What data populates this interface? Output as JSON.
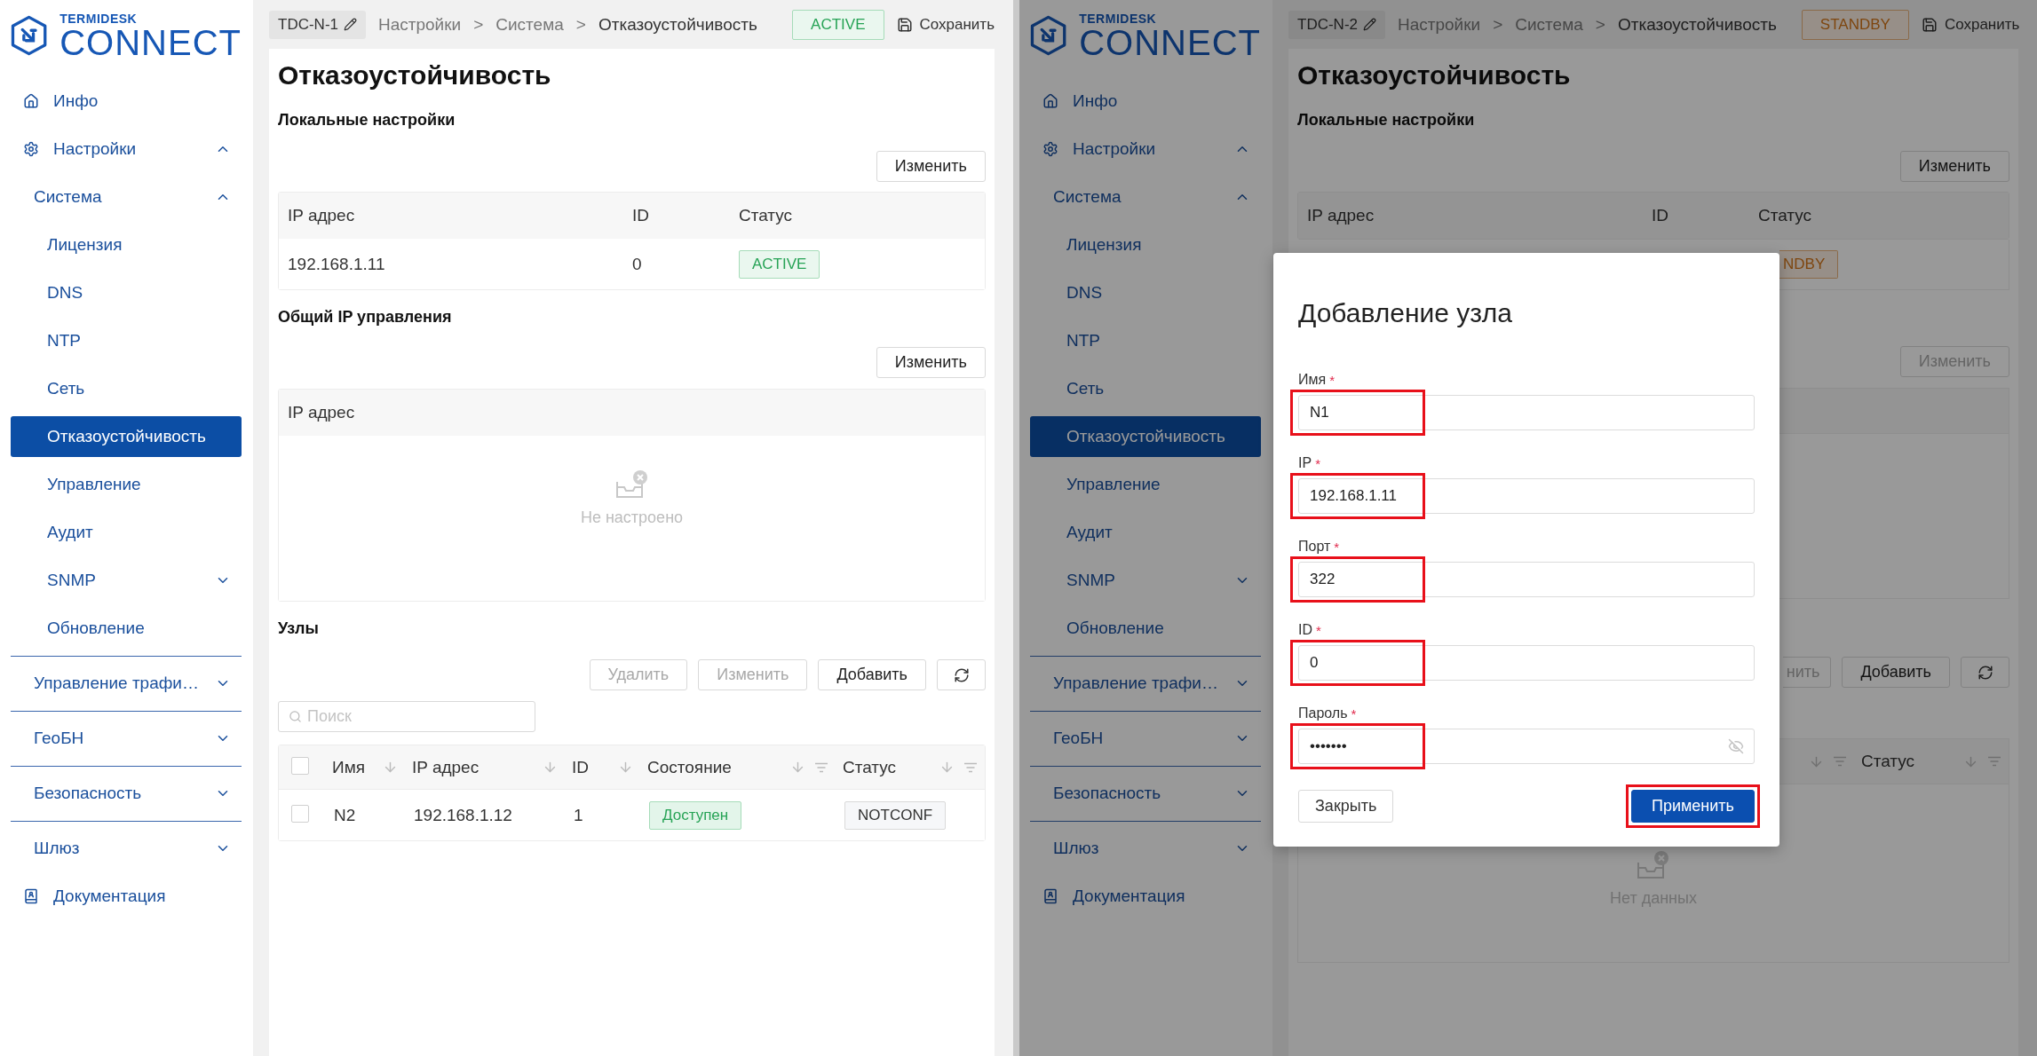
{
  "panes": [
    {
      "logo": {
        "brand": "TERMIDESK",
        "product": "CONNECT"
      },
      "sidebar": [
        {
          "label": "Инфо",
          "selected": false
        },
        {
          "label": "Настройки",
          "selected": false,
          "expanded": true,
          "children": [
            {
              "label": "Система",
              "selected": false,
              "expanded": true,
              "children": [
                {
                  "label": "Лицензия",
                  "selected": false
                },
                {
                  "label": "DNS",
                  "selected": false
                },
                {
                  "label": "NTP",
                  "selected": false
                },
                {
                  "label": "Сеть",
                  "selected": false
                },
                {
                  "label": "Отказоустойчивость",
                  "selected": true
                },
                {
                  "label": "Управление",
                  "selected": false
                },
                {
                  "label": "Аудит",
                  "selected": false
                },
                {
                  "label": "SNMP",
                  "selected": false,
                  "expanded": false
                },
                {
                  "label": "Обновление",
                  "selected": false
                }
              ]
            },
            {
              "label": "Управление трафи…",
              "selected": false,
              "expanded": false
            },
            {
              "label": "ГеоБН",
              "selected": false,
              "expanded": false
            },
            {
              "label": "Безопасность",
              "selected": false,
              "expanded": false
            },
            {
              "label": "Шлюз",
              "selected": false,
              "expanded": false
            }
          ]
        },
        {
          "label": "Документация",
          "selected": false
        }
      ],
      "header": {
        "node": "TDC-N-1",
        "breadcrumbs": [
          {
            "kind": "link",
            "label": "Настройки"
          },
          {
            "kind": "sep",
            "label": ">"
          },
          {
            "kind": "link",
            "label": "Система"
          },
          {
            "kind": "sep",
            "label": ">"
          },
          {
            "kind": "current",
            "label": "Отказоустойчивость"
          }
        ],
        "role": {
          "label": "ACTIVE",
          "kind": "active"
        },
        "save": "Сохранить"
      },
      "page": {
        "kind": "full",
        "title": "Отказоустойчивость",
        "local": {
          "heading": "Локальные настройки",
          "edit": {
            "label": "Изменить",
            "disabled": false
          },
          "columns": [
            "IP адрес",
            "ID",
            "Статус"
          ],
          "rows": [
            {
              "ip": "192.168.1.11",
              "id": "0",
              "status": {
                "label": "ACTIVE",
                "kind": "active"
              }
            }
          ]
        },
        "management": {
          "heading": "Общий IP управления",
          "edit": {
            "label": "Изменить",
            "disabled": false
          },
          "columns": [
            "IP адрес"
          ],
          "empty": "Не настроено"
        },
        "nodes": {
          "heading": "Узлы",
          "actions": [
            {
              "label": "Удалить",
              "disabled": true
            },
            {
              "label": "Изменить",
              "disabled": true
            },
            {
              "label": "Добавить",
              "disabled": false
            }
          ],
          "search": {
            "placeholder": "Поиск"
          },
          "all_checked": false,
          "columns": [
            {
              "label": "Имя",
              "sortable": true,
              "filterable": false
            },
            {
              "label": "IP адрес",
              "sortable": true,
              "filterable": false
            },
            {
              "label": "ID",
              "sortable": true,
              "filterable": false
            },
            {
              "label": "Состояние",
              "sortable": true,
              "filterable": true
            },
            {
              "label": "Статус",
              "sortable": true,
              "filterable": true
            }
          ],
          "rows": [
            {
              "checked": false,
              "name": "N2",
              "ip": "192.168.1.12",
              "id": "1",
              "state": {
                "label": "Доступен",
                "kind": "ok"
              },
              "status": {
                "label": "NOTCONF",
                "kind": "neutral"
              }
            }
          ]
        }
      }
    },
    {
      "logo": {
        "brand": "TERMIDESK",
        "product": "CONNECT"
      },
      "sidebar": [
        {
          "label": "Инфо",
          "selected": false
        },
        {
          "label": "Настройки",
          "selected": false,
          "expanded": true,
          "children": [
            {
              "label": "Система",
              "selected": false,
              "expanded": true,
              "children": [
                {
                  "label": "Лицензия",
                  "selected": false
                },
                {
                  "label": "DNS",
                  "selected": false
                },
                {
                  "label": "NTP",
                  "selected": false
                },
                {
                  "label": "Сеть",
                  "selected": false
                },
                {
                  "label": "Отказоустойчивость",
                  "selected": true
                },
                {
                  "label": "Управление",
                  "selected": false
                },
                {
                  "label": "Аудит",
                  "selected": false
                },
                {
                  "label": "SNMP",
                  "selected": false,
                  "expanded": false
                },
                {
                  "label": "Обновление",
                  "selected": false
                }
              ]
            },
            {
              "label": "Управление трафи…",
              "selected": false,
              "expanded": false
            },
            {
              "label": "ГеоБН",
              "selected": false,
              "expanded": false
            },
            {
              "label": "Безопасность",
              "selected": false,
              "expanded": false
            },
            {
              "label": "Шлюз",
              "selected": false,
              "expanded": false
            }
          ]
        },
        {
          "label": "Документация",
          "selected": false
        }
      ],
      "header": {
        "node": "TDC-N-2",
        "breadcrumbs": [
          {
            "kind": "link",
            "label": "Настройки"
          },
          {
            "kind": "sep",
            "label": ">"
          },
          {
            "kind": "link",
            "label": "Система"
          },
          {
            "kind": "sep",
            "label": ">"
          },
          {
            "kind": "current",
            "label": "Отказоустойчивость"
          }
        ],
        "role": {
          "label": "STANDBY",
          "kind": "standby"
        },
        "save": "Сохранить"
      },
      "page": {
        "kind": "behind_dialog",
        "title": "Отказоустойчивость",
        "local": {
          "heading": "Локальные настройки",
          "edit": {
            "label": "Изменить",
            "disabled": false
          },
          "columns": [
            "IP адрес",
            "ID",
            "Статус"
          ],
          "status_fragment": {
            "label": "NDBY",
            "kind": "standby"
          }
        },
        "management": {
          "edit": {
            "label": "Изменить",
            "disabled": true
          }
        },
        "nodes": {
          "actions": [
            {
              "label": "нить",
              "disabled": true
            },
            {
              "label": "Добавить",
              "disabled": false
            }
          ],
          "columns": [
            {
              "sortable": true,
              "filterable": true
            },
            {
              "label": "Статус",
              "sortable": true,
              "filterable": true
            }
          ],
          "empty": "Нет данных"
        }
      },
      "dialog": {
        "title": "Добавление узла",
        "fields": [
          {
            "kind": "text",
            "label": "Имя",
            "mark": "*",
            "value": "N1",
            "highlighted": true
          },
          {
            "kind": "text",
            "label": "IP",
            "mark": "*",
            "value": "192.168.1.11",
            "highlighted": true
          },
          {
            "kind": "text",
            "label": "Порт",
            "mark": "*",
            "value": "322",
            "highlighted": true
          },
          {
            "kind": "text",
            "label": "ID",
            "mark": "*",
            "value": "0",
            "highlighted": true
          },
          {
            "kind": "password",
            "label": "Пароль",
            "mark": "*",
            "value": "•••••••",
            "highlighted": true
          }
        ],
        "buttons": [
          {
            "kind": "secondary",
            "label": "Закрыть",
            "highlighted": false
          },
          {
            "kind": "primary",
            "label": "Применить",
            "highlighted": true
          }
        ]
      }
    }
  ]
}
